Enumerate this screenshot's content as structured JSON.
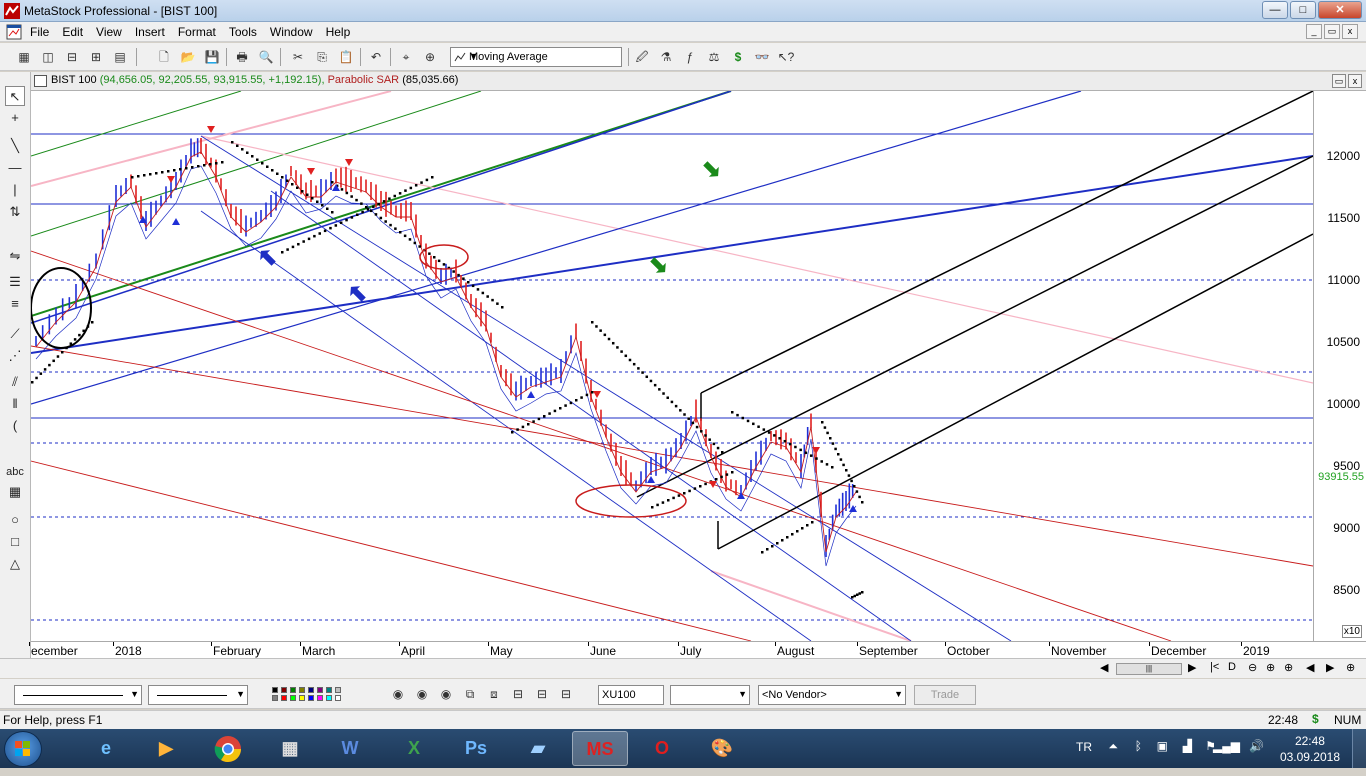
{
  "window": {
    "title": "MetaStock Professional - [BIST 100]",
    "controls": {
      "minimize": "—",
      "maximize": "□",
      "close": "✕"
    }
  },
  "menu": {
    "items": [
      "File",
      "Edit",
      "View",
      "Insert",
      "Format",
      "Tools",
      "Window",
      "Help"
    ],
    "mdi_controls": {
      "minimize": "_",
      "restore": "▭",
      "close": "x"
    }
  },
  "toolbar": {
    "indicator_combo": "Moving Average"
  },
  "chart": {
    "header_symbol": "BIST 100",
    "header_ohlc": "(94,656.05, 92,205.55, 93,915.55, +1,192.15),",
    "header_indicator": "Parabolic SAR",
    "header_indicator_value": "(85,035.66)",
    "price_labels": [
      "12000",
      "11500",
      "11000",
      "10500",
      "10000",
      "9500",
      "9000",
      "8500"
    ],
    "last_price": "93915.55",
    "scale_multiplier": "x10",
    "time_labels": [
      "ecember",
      "2018",
      "February",
      "March",
      "April",
      "May",
      "June",
      "July",
      "August",
      "September",
      "October",
      "November",
      "December",
      "2019"
    ],
    "colors": {
      "up_bar": "#1f2fd6",
      "down_bar": "#e02020",
      "sar_dots": "#000000",
      "green_channel": "#1a8a1a",
      "pink_line": "#f7b5c5",
      "blue_line": "#1e2ec4",
      "black_channel": "#000000",
      "red_line": "#c81c1c"
    }
  },
  "chart_data": {
    "type": "candlestick-like price chart with trendlines",
    "symbol": "BIST 100",
    "price_axis_ticks": [
      8500,
      9000,
      9500,
      10000,
      10500,
      11000,
      11500,
      12000
    ],
    "last_close": 93915.55,
    "header_values": {
      "high": 94656.05,
      "low": 92205.55,
      "close": 93915.55,
      "change": 1192.15,
      "parabolic_sar": 85035.66
    },
    "time_axis": [
      "December",
      "2018",
      "February",
      "March",
      "April",
      "May",
      "June",
      "July",
      "August",
      "September",
      "October",
      "November",
      "December",
      "2019"
    ]
  },
  "bottom_toolbar": {
    "symbol_input": "XU100",
    "vendor_combo": "<No Vendor>",
    "trade_button": "Trade"
  },
  "status": {
    "help_text": "For Help, press F1",
    "time": "22:48",
    "currency": "$",
    "num": "NUM"
  },
  "taskbar": {
    "language": "TR",
    "clock_time": "22:48",
    "clock_date": "03.09.2018",
    "apps": [
      "ie-icon",
      "media-player-icon",
      "chrome-icon",
      "calculator-icon",
      "word-icon",
      "excel-icon",
      "photoshop-icon",
      "notes-icon",
      "metastock-icon",
      "opera-icon",
      "paint-icon"
    ]
  }
}
